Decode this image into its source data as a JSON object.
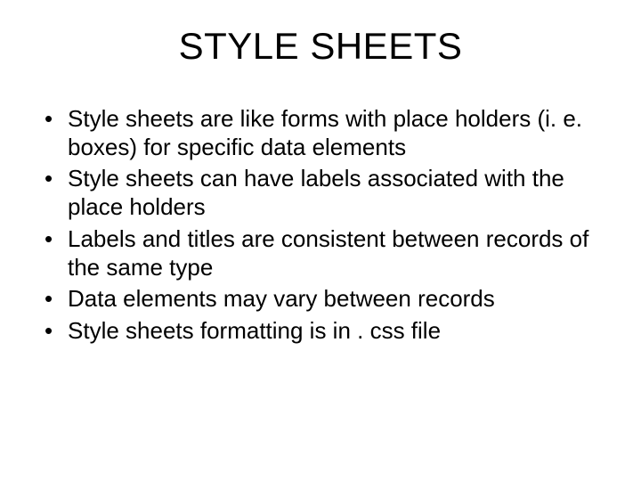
{
  "slide": {
    "title": "STYLE SHEETS",
    "bullets": [
      "Style sheets are like forms with place holders (i. e. boxes) for specific data elements",
      "Style sheets can have labels associated with the place holders",
      "Labels and titles are consistent between records of the same type",
      "Data elements may vary between records",
      "Style sheets formatting is in . css file"
    ]
  }
}
